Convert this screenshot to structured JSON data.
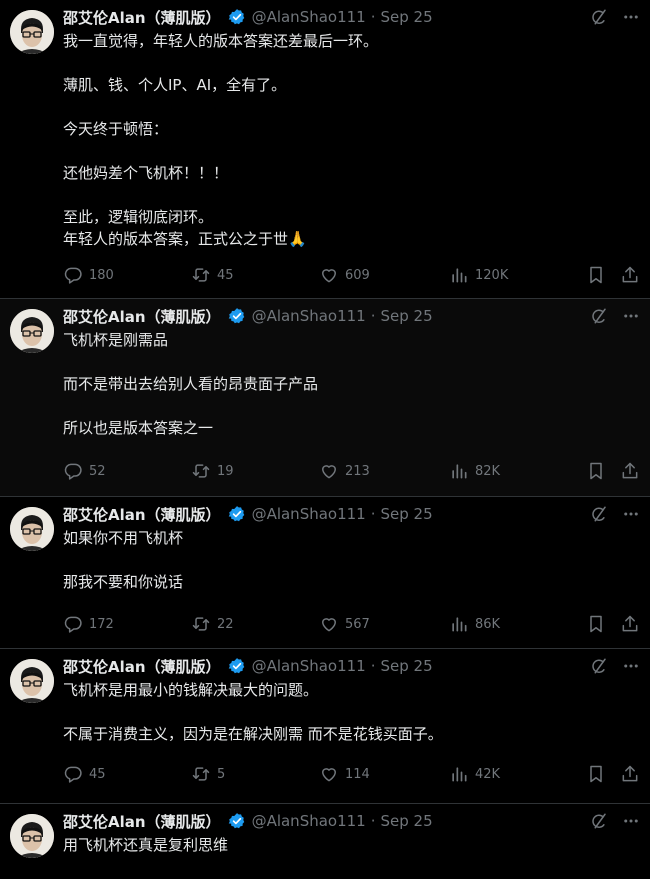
{
  "author": {
    "name": "邵艾伦Alan（薄肌版）",
    "handle": "@AlanShao111",
    "separator": "·",
    "verified": true
  },
  "colors": {
    "background": "#000000",
    "text": "#e7e9ea",
    "muted": "#71767b",
    "verified": "#1d9bf0",
    "divider": "#2f3336"
  },
  "icons": {
    "header": [
      "grok-icon",
      "more-icon"
    ],
    "actions": [
      "reply-icon",
      "retweet-icon",
      "like-icon",
      "views-icon",
      "bookmark-icon",
      "share-icon"
    ]
  },
  "tweets": [
    {
      "date": "Sep 25",
      "text": "我一直觉得，年轻人的版本答案还差最后一环。\n\n薄肌、钱、个人IP、AI，全有了。\n\n今天终于顿悟：\n\n还他妈差个飞机杯！！！\n\n至此，逻辑彻底闭环。\n年轻人的版本答案，正式公之于世🙏",
      "replies": "180",
      "reposts": "45",
      "likes": "609",
      "views": "120K"
    },
    {
      "date": "Sep 25",
      "text": "飞机杯是刚需品\n\n而不是带出去给别人看的昂贵面子产品\n\n所以也是版本答案之一",
      "replies": "52",
      "reposts": "19",
      "likes": "213",
      "views": "82K"
    },
    {
      "date": "Sep 25",
      "text": "如果你不用飞机杯\n\n那我不要和你说话",
      "replies": "172",
      "reposts": "22",
      "likes": "567",
      "views": "86K"
    },
    {
      "date": "Sep 25",
      "text": "飞机杯是用最小的钱解决最大的问题。\n\n不属于消费主义，因为是在解决刚需 而不是花钱买面子。",
      "replies": "45",
      "reposts": "5",
      "likes": "114",
      "views": "42K"
    },
    {
      "date": "Sep 25",
      "text": "用飞机杯还真是复利思维"
    }
  ]
}
